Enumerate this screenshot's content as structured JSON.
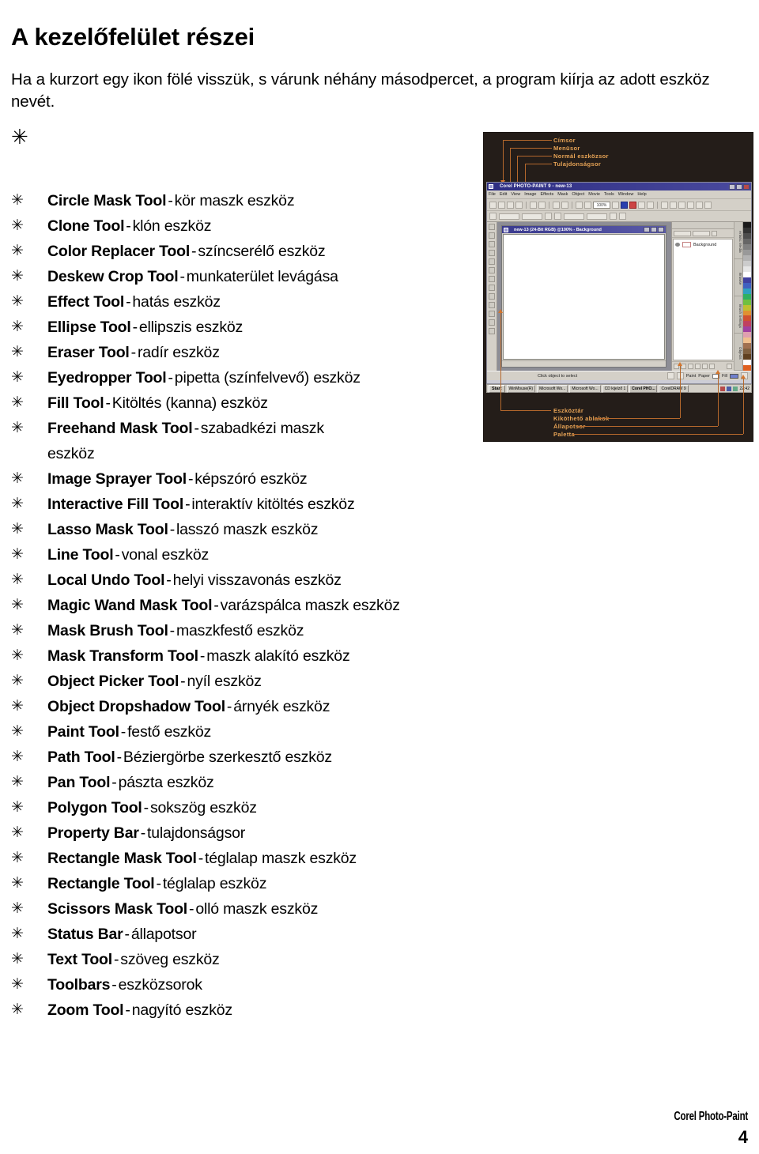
{
  "document": {
    "title": "A kezelőfelület részei",
    "intro": "Ha a kurzort egy ikon fölé visszük, s várunk néhány másodpercet, a program kiírja az adott eszköz nevét.",
    "bullet_glyph": "✳",
    "footer_brand": "Corel Photo-Paint",
    "page_number": "4"
  },
  "tools": [
    {
      "name": "Circle Mask Tool",
      "dash": "-",
      "desc": "kör maszk eszköz"
    },
    {
      "name": "Clone Tool",
      "dash": "-",
      "desc": "klón eszköz"
    },
    {
      "name": "Color Replacer Tool",
      "dash": "-",
      "desc": "színcserélő eszköz"
    },
    {
      "name": "Deskew Crop Tool",
      "dash": "-",
      "desc": "munkaterület levágása"
    },
    {
      "name": "Effect Tool",
      "dash": "-",
      "desc": "hatás eszköz"
    },
    {
      "name": "Ellipse Tool",
      "dash": "-",
      "desc": "ellipszis eszköz"
    },
    {
      "name": "Eraser Tool",
      "dash": "-",
      "desc": "radír eszköz"
    },
    {
      "name": "Eyedropper Tool",
      "dash": "-",
      "desc": "pipetta (színfelvevő) eszköz"
    },
    {
      "name": "Fill Tool",
      "dash": "-",
      "desc": "Kitöltés (kanna) eszköz"
    },
    {
      "name": "Freehand Mask Tool",
      "dash": "-",
      "desc": "szabadkézi maszk",
      "desc2": "eszköz"
    },
    {
      "name": "Image Sprayer Tool",
      "dash": "-",
      "desc": "képszóró eszköz"
    },
    {
      "name": "Interactive Fill Tool",
      "dash": "-",
      "desc": "interaktív kitöltés eszköz"
    },
    {
      "name": "Lasso Mask Tool",
      "dash": "-",
      "desc": "lasszó maszk eszköz"
    },
    {
      "name": "Line Tool",
      "dash": "-",
      "desc": "vonal eszköz"
    },
    {
      "name": "Local Undo Tool",
      "dash": "-",
      "desc": "helyi visszavonás eszköz"
    },
    {
      "name": "Magic Wand Mask Tool",
      "dash": "-",
      "desc": "varázspálca maszk eszköz"
    },
    {
      "name": "Mask Brush Tool",
      "dash": "-",
      "desc": "maszkfestő eszköz"
    },
    {
      "name": "Mask Transform Tool",
      "dash": "-",
      "desc": "maszk alakító eszköz"
    },
    {
      "name": "Object Picker Tool",
      "dash": "-",
      "desc": "nyíl eszköz"
    },
    {
      "name": "Object Dropshadow Tool",
      "dash": "-",
      "desc": "árnyék eszköz"
    },
    {
      "name": "Paint Tool",
      "dash": "-",
      "desc": "festő eszköz"
    },
    {
      "name": "Path Tool",
      "dash": "-",
      "desc": "Béziergörbe szerkesztő eszköz"
    },
    {
      "name": "Pan Tool",
      "dash": "-",
      "desc": "pászta eszköz"
    },
    {
      "name": "Polygon Tool",
      "dash": "-",
      "desc": "sokszög eszköz"
    },
    {
      "name": "Property Bar",
      "dash": "-",
      "desc": "tulajdonságsor"
    },
    {
      "name": "Rectangle Mask Tool",
      "dash": "-",
      "desc": "téglalap maszk eszköz"
    },
    {
      "name": "Rectangle Tool",
      "dash": "-",
      "desc": "téglalap eszköz"
    },
    {
      "name": "Scissors Mask Tool",
      "dash": "-",
      "desc": "olló maszk eszköz"
    },
    {
      "name": "Status Bar",
      "dash": "-",
      "desc": "állapotsor"
    },
    {
      "name": "Text Tool",
      "dash": "-",
      "desc": "szöveg eszköz"
    },
    {
      "name": "Toolbars",
      "dash": "-",
      "desc": "eszközsorok"
    },
    {
      "name": "Zoom Tool",
      "dash": "-",
      "desc": "nagyító eszköz"
    }
  ],
  "figure": {
    "background_color": "#241d19",
    "callout_color": "#e8a456",
    "leader_color": "#b5682c",
    "callouts_top": [
      "Címsor",
      "Menüsor",
      "Normál eszközsor",
      "Tulajdonságsor"
    ],
    "callouts_bottom": [
      "Eszköztár",
      "Kiköthető ablakok",
      "Állapotsor",
      "Paletta"
    ],
    "app": {
      "title": "Corel PHOTO-PAINT 9 - new-13",
      "menu": [
        "File",
        "Edit",
        "View",
        "Image",
        "Effects",
        "Mask",
        "Object",
        "Movie",
        "Tools",
        "Window",
        "Help"
      ],
      "zoom_value": "100%",
      "document_title": "new-13 (24-Bit RGB) @100% - Background",
      "layer_name": "Background",
      "docker_tabs": [
        "Artistic Media",
        "Browse",
        "Brush Settings",
        "Objects"
      ],
      "status_hint": "Click object to select",
      "status_paint_label": "Paint",
      "status_paper_label": "Paper",
      "status_fill_label": "Fill"
    },
    "taskbar": {
      "start_label": "Start",
      "buttons": [
        "WinMouse(R)",
        "Microsoft Wo...",
        "Microsoft Wo...",
        "CD kijelző 1",
        "Corel PHO...",
        "CorelDRAW 9"
      ],
      "clock": "22:42"
    },
    "palette_colors": [
      "#1a1a1a",
      "#333333",
      "#4d4d4d",
      "#666666",
      "#808080",
      "#999999",
      "#b3b3b3",
      "#cccccc",
      "#e6e6e6",
      "#ffffff",
      "#4040a0",
      "#4060c0",
      "#30a0c0",
      "#30b060",
      "#70c040",
      "#c0c030",
      "#e09030",
      "#d05030",
      "#c04060",
      "#a040a0",
      "#e0a0b0",
      "#f0c090",
      "#a07050",
      "#806040",
      "#604020",
      "#ffffff",
      "#e06020"
    ]
  }
}
